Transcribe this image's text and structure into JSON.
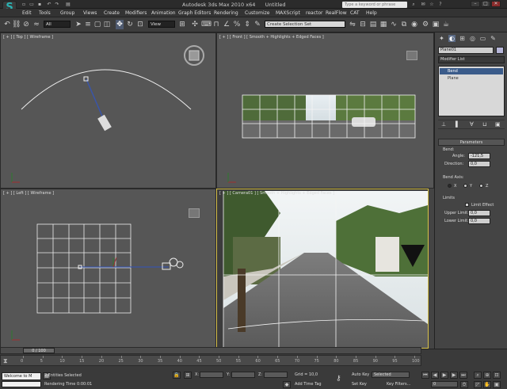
{
  "titlebar": {
    "app_title": "Autodesk 3ds Max 2010 x64",
    "doc_title": "Untitled",
    "search_placeholder": "Type a keyword or phrase"
  },
  "menu": [
    "Edit",
    "Tools",
    "Group",
    "Views",
    "Create",
    "Modifiers",
    "Animation",
    "Graph Editors",
    "Rendering",
    "Customize",
    "MAXScript",
    "reactor",
    "RealFlow",
    "CAT",
    "Help"
  ],
  "toolbar": {
    "selection_filter": "All",
    "reference_coord": "View",
    "named_selection": "Create Selection Set"
  },
  "viewports": {
    "top": "[ + ] [ Top ] [ Wireframe ]",
    "front": "[ + ] [ Front ] [ Smooth + Highlights + Edged Faces ]",
    "left": "[ + ] [ Left ] [ Wireframe ]",
    "perspective": "[ + ] [ Camera01 ] [ Smooth + Highlights + Edged Faces ]"
  },
  "panel": {
    "object_name": "Plane01",
    "modifier_list": "Modifier List",
    "stack": [
      "Bend",
      "Plane"
    ],
    "rollout_title": "Parameters",
    "bend_group": "Bend:",
    "angle_label": "Angle:",
    "angle_value": "-121,5",
    "direction_label": "Direction:",
    "direction_value": "0,0",
    "axis_group": "Bend Axis:",
    "axis_x": "X",
    "axis_y": "Y",
    "axis_z": "Z",
    "limits_group": "Limits",
    "limit_effect": "Limit Effect",
    "upper_label": "Upper Limit:",
    "upper_value": "0,0",
    "lower_label": "Lower Limit:",
    "lower_value": "0,0"
  },
  "timeline": {
    "frame_range": "0 / 100",
    "ticks": [
      "0",
      "5",
      "10",
      "15",
      "20",
      "25",
      "30",
      "35",
      "40",
      "45",
      "50",
      "55",
      "60",
      "65",
      "70",
      "75",
      "80",
      "85",
      "90",
      "95",
      "100"
    ]
  },
  "status": {
    "listener": "Welcome to M",
    "selection_info": "2 Entities Selected",
    "render_time": "Rendering Time  0:00:01",
    "x_label": "X:",
    "y_label": "Y:",
    "z_label": "Z:",
    "grid": "Grid = 10,0",
    "add_time_tag": "Add Time Tag",
    "auto_key": "Auto Key",
    "key_mode": "Selected",
    "set_key": "Set Key",
    "key_filters": "Key Filters...",
    "current_frame": "0"
  },
  "colors": {
    "active_viewport_border": "#d8c24a",
    "viewport_bg": "#565656",
    "selected_stack_item": "#3a5b8a"
  }
}
